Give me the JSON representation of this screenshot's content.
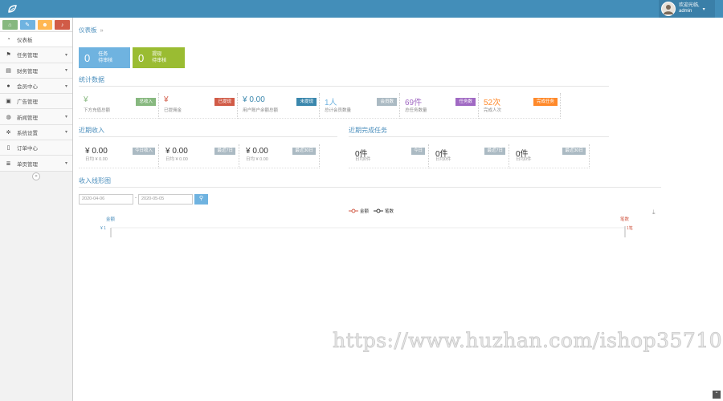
{
  "header": {
    "user_name": "欢迎光临,",
    "user_role": "admin"
  },
  "shortcuts": [
    {
      "icon": "home-icon",
      "color": "#87b87f",
      "glyph": "⌂"
    },
    {
      "icon": "pencil-icon",
      "color": "#6fb3e0",
      "glyph": "✎"
    },
    {
      "icon": "group-icon",
      "color": "#ffb752",
      "glyph": "☻"
    },
    {
      "icon": "bell-icon",
      "color": "#d15b47",
      "glyph": "♪"
    }
  ],
  "menu": [
    {
      "label": "仪表板",
      "icon": "dashboard-icon",
      "glyph": "◔",
      "has_sub": false
    },
    {
      "label": "任务管理",
      "icon": "flag-icon",
      "glyph": "⚑",
      "has_sub": true
    },
    {
      "label": "财务管理",
      "icon": "print-icon",
      "glyph": "▤",
      "has_sub": true
    },
    {
      "label": "会员中心",
      "icon": "user-icon",
      "glyph": "●",
      "has_sub": true
    },
    {
      "label": "广告管理",
      "icon": "picture-icon",
      "glyph": "▣",
      "has_sub": false
    },
    {
      "label": "新闻管理",
      "icon": "globe-icon",
      "glyph": "◍",
      "has_sub": true
    },
    {
      "label": "系统设置",
      "icon": "cog-icon",
      "glyph": "✲",
      "has_sub": true
    },
    {
      "label": "订单中心",
      "icon": "bookmark-icon",
      "glyph": "▯",
      "has_sub": false
    },
    {
      "label": "单页管理",
      "icon": "list-icon",
      "glyph": "≣",
      "has_sub": true
    }
  ],
  "breadcrumb": {
    "title": "仪表板",
    "sep": "»"
  },
  "top_boxes": [
    {
      "num": "0",
      "line1": "任务",
      "line2": "待审核",
      "color": "#6fb3e0"
    },
    {
      "num": "0",
      "line1": "提现",
      "line2": "待审核",
      "color": "#9abc32"
    }
  ],
  "sections": {
    "stats": "统计数据",
    "recent_income": "近期收入",
    "recent_tasks": "近期完成任务",
    "chart": "收入线形图"
  },
  "stats": [
    {
      "val": "¥",
      "desc": "下方充值总额",
      "tag": "总收入",
      "tag_color": "#87b87f",
      "val_color": "#87b87f"
    },
    {
      "val": "¥",
      "desc": "已提佣金",
      "tag": "已提现",
      "tag_color": "#d15b47",
      "val_color": "#d15b47"
    },
    {
      "val": "¥ 0.00",
      "desc": "用户账户余额总额",
      "tag": "未提现",
      "tag_color": "#3a87ad",
      "val_color": "#3a87ad"
    },
    {
      "val": "1人",
      "desc": "总计会员数量",
      "tag": "会员数",
      "tag_color": "#abbac3",
      "val_color": "#6fb3e0"
    },
    {
      "val": "69件",
      "desc": "总任务数量",
      "tag": "任务数",
      "tag_color": "#a069c3",
      "val_color": "#a069c3"
    },
    {
      "val": "52次",
      "desc": "完成人次",
      "tag": "完成任务",
      "tag_color": "#ff892a",
      "val_color": "#ff892a"
    }
  ],
  "income": [
    {
      "val": "¥ 0.00",
      "sub": "日均 ¥ 0.00",
      "tag": "今日收入"
    },
    {
      "val": "¥ 0.00",
      "sub": "日均 ¥ 0.00",
      "tag": "最近7日"
    },
    {
      "val": "¥ 0.00",
      "sub": "日均 ¥ 0.00",
      "tag": "最近30日"
    }
  ],
  "tasks": [
    {
      "val": "0件",
      "sub": "日均0件",
      "tag": "今日"
    },
    {
      "val": "0件",
      "sub": "日均0件",
      "tag": "最近7日"
    },
    {
      "val": "0件",
      "sub": "日均0件",
      "tag": "最近30日"
    }
  ],
  "filter": {
    "start_date": "2020-04-06",
    "end_date": "2020-05-05",
    "search_glyph": "⚲"
  },
  "chart_data": {
    "type": "line",
    "series": [
      {
        "name": "金额",
        "color": "#d15b47"
      },
      {
        "name": "笔数",
        "color": "#333333"
      }
    ],
    "left_axis_label": "金额",
    "right_axis_label": "笔数",
    "left_tick": "¥ 1",
    "right_tick": "1笔"
  },
  "watermark": "https://www.huzhan.com/ishop35710",
  "scroll_top": "⌃"
}
